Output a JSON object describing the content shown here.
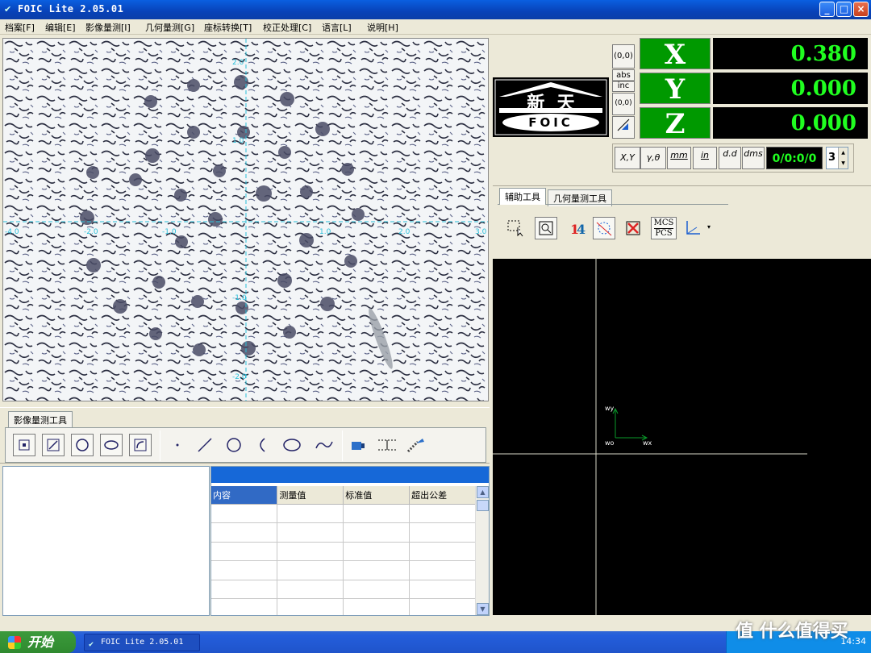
{
  "window": {
    "title": "FOIC Lite 2.05.01",
    "min": "_",
    "max": "□",
    "close": "×"
  },
  "menu": [
    "档案[F]",
    "编辑[E]",
    "影像量测[I]",
    "几何量测[G]",
    "座标转换[T]",
    "校正处理[C]",
    "语言[L]",
    "说明[H]"
  ],
  "image_view": {
    "x_ticks": [
      "-4.0",
      "-2.0",
      "-1.0",
      "1.0",
      "2.0",
      "3.0"
    ],
    "y_ticks": [
      "2.0",
      "1.0",
      "-1.0",
      "-2.0"
    ]
  },
  "image_tools": {
    "tab": "影像量测工具"
  },
  "table": {
    "columns": [
      "内容",
      "测量值",
      "标准值",
      "超出公差"
    ]
  },
  "dro": {
    "logo_cn": "新  天",
    "logo_en": "FOIC",
    "origin_btn": "(0,0)",
    "abs": "abs",
    "inc": "inc",
    "origin_btn2": "(0,0)",
    "x_label": "X",
    "x_value": "0.380",
    "y_label": "Y",
    "y_value": "0.000",
    "z_label": "Z",
    "z_value": "0.000"
  },
  "units": {
    "xy": "X,Y",
    "rt": "γ,θ",
    "mm": "mm",
    "in": "in",
    "dd": "d.d",
    "dms": "dms",
    "counter": "0/0:0/0",
    "spin": "3"
  },
  "right_tabs": {
    "tab1": "辅助工具",
    "tab2": "几何量测工具",
    "mcs": "MCS",
    "pcs": "PCS"
  },
  "coord_view": {
    "wy": "wy",
    "wo": "wo",
    "wx": "wx"
  },
  "taskbar": {
    "start": "开始",
    "item": "FOIC Lite 2.05.01",
    "clock": "14:34"
  },
  "watermark": "值 什么值得买",
  "colors": {
    "dro_green": "#009900",
    "dro_text": "#20ff20",
    "crosshair": "#29bfd9"
  }
}
